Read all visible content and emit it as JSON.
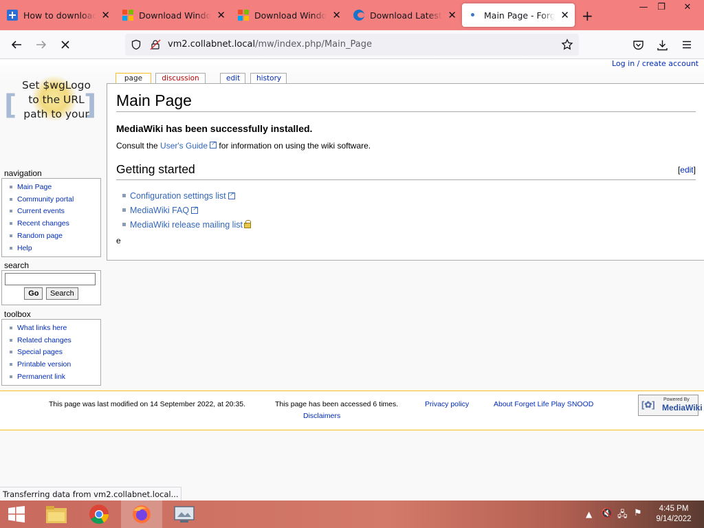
{
  "browser": {
    "tabs": [
      {
        "title": "How to download Wi",
        "favicon": "blue-plus-icon"
      },
      {
        "title": "Download Windows",
        "favicon": "microsoft-icon"
      },
      {
        "title": "Download Windows",
        "favicon": "microsoft-icon"
      },
      {
        "title": "Download Latest Dri",
        "favicon": "blue-circle-icon"
      },
      {
        "title": "Main Page - Forget L",
        "favicon": "loading-dot-icon",
        "active": true
      }
    ],
    "url_host": "vm2.collabnet.local",
    "url_path": "/mw/index.php/Main_Page",
    "status": "Transferring data from vm2.collabnet.local...",
    "tabbar_color": "#f47f7f"
  },
  "wiki": {
    "login": "Log in / create account",
    "logo_text": [
      "Set $wgLogo",
      "to the URL",
      "path to your"
    ],
    "page_tabs": [
      "page",
      "discussion",
      "edit",
      "history"
    ],
    "title": "Main Page",
    "lead": "MediaWiki has been successfully installed.",
    "para_prefix": "Consult the",
    "para_link": "User's Guide",
    "para_suffix": "for information on using the wiki software.",
    "section_title": "Getting started",
    "section_edit_open": "[",
    "section_edit": "edit",
    "section_edit_close": "]",
    "links": [
      "Configuration settings list",
      "MediaWiki FAQ",
      "MediaWiki release mailing list"
    ],
    "extra_text": "e",
    "navigation": {
      "title": "navigation",
      "items": [
        "Main Page",
        "Community portal",
        "Current events",
        "Recent changes",
        "Random page",
        "Help"
      ]
    },
    "search": {
      "title": "search",
      "go": "Go",
      "search": "Search",
      "value": ""
    },
    "toolbox": {
      "title": "toolbox",
      "items": [
        "What links here",
        "Related changes",
        "Special pages",
        "Printable version",
        "Permanent link"
      ]
    },
    "footer": {
      "modified": "This page was last modified on 14 September 2022, at 20:35.",
      "accessed": "This page has been accessed 6 times.",
      "privacy": "Privacy policy",
      "about": "About Forget Life Play SNOOD",
      "disclaimers": "Disclaimers",
      "badge_small": "Powered By",
      "badge_big": "MediaWiki"
    }
  },
  "taskbar": {
    "time": "4:45 PM",
    "date": "9/14/2022",
    "apps": [
      "windows-start-icon",
      "file-explorer-icon",
      "chrome-icon",
      "firefox-icon",
      "screen-app-icon"
    ]
  }
}
